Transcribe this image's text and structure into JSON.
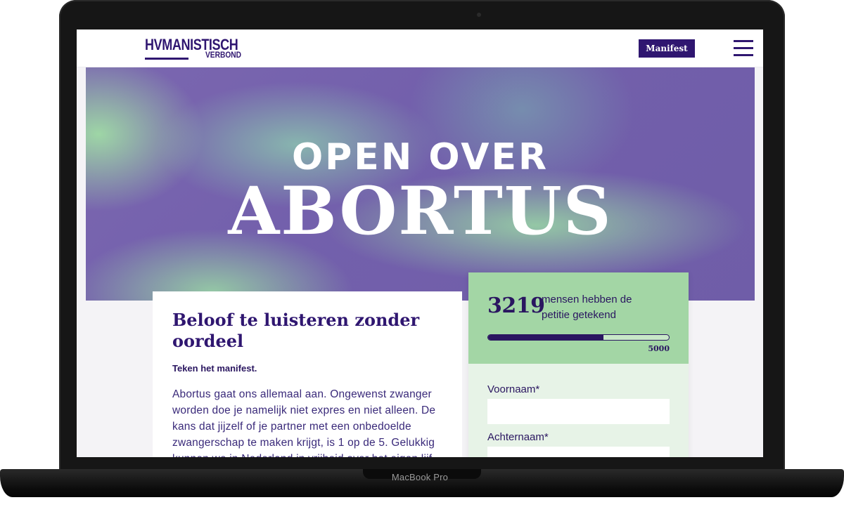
{
  "device": {
    "label": "MacBook Pro"
  },
  "header": {
    "logo_top": "HVMANISTISCH",
    "logo_bottom": "VERBOND",
    "manifest_label": "Manifest"
  },
  "hero": {
    "line1": "OPEN OVER",
    "line2": "ABORTUS"
  },
  "article": {
    "title": "Beloof te luisteren zonder oordeel",
    "subtitle": "Teken het manifest.",
    "body": "Abortus gaat ons allemaal aan. Ongewenst zwanger worden doe je namelijk niet expres en niet alleen. De kans dat jijzelf of je partner met een onbedoelde zwangerschap te maken krijgt, is 1 op de 5. Gelukkig kunnen we in Nederland in vrijheid over het eigen lijf"
  },
  "petition": {
    "count": "3219",
    "count_label": "mensen hebben de petitie getekend",
    "progress_fraction": 0.64,
    "goal": "5000",
    "fields": [
      {
        "label": "Voornaam*",
        "value": ""
      },
      {
        "label": "Achternaam*",
        "value": ""
      }
    ]
  },
  "colors": {
    "brand": "#2f1670",
    "green": "#a3d6a5",
    "hero_purple": "#7360ac"
  }
}
